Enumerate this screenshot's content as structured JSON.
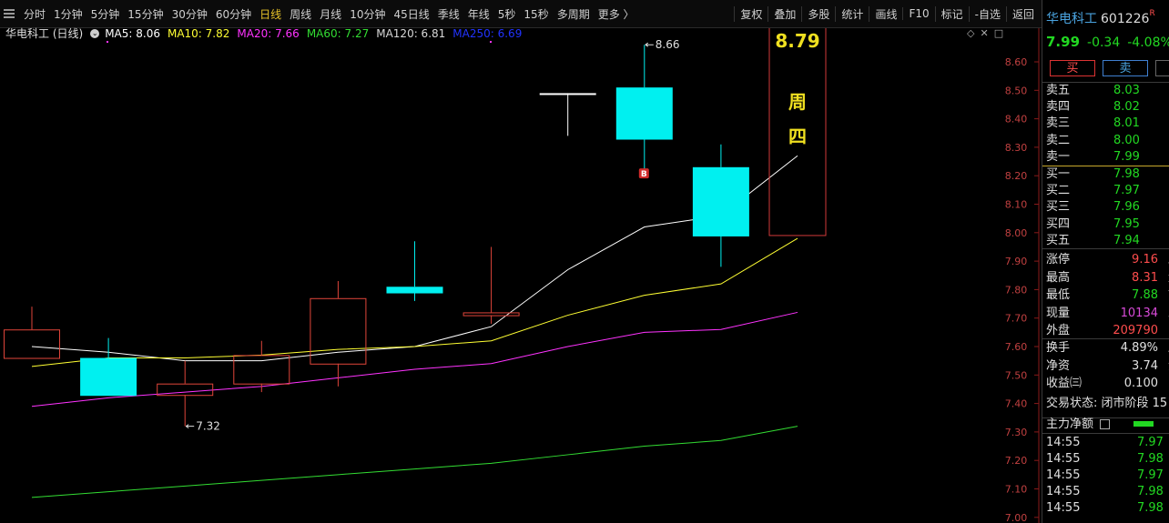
{
  "toolbar": {
    "periods": [
      "分时",
      "1分钟",
      "5分钟",
      "15分钟",
      "30分钟",
      "60分钟",
      "日线",
      "周线",
      "月线",
      "10分钟",
      "45日线",
      "季线",
      "年线",
      "5秒",
      "15秒",
      "多周期",
      "更多 〉"
    ],
    "active_period": "日线",
    "actions": [
      "复权",
      "叠加",
      "多股",
      "统计",
      "画线",
      "F10",
      "标记",
      "-自选",
      "返回"
    ]
  },
  "legend": {
    "title": "华电科工 (日线)",
    "items": [
      {
        "label": "MA5: 8.06",
        "color": "#ffffff"
      },
      {
        "label": "MA10: 7.82",
        "color": "#ffff33"
      },
      {
        "label": "MA20: 7.66",
        "color": "#ff33ff"
      },
      {
        "label": "MA60: 7.27",
        "color": "#33dd33"
      },
      {
        "label": "MA120: 6.81",
        "color": "#d8d8d8"
      },
      {
        "label": "MA250: 6.69",
        "color": "#2233ff"
      }
    ]
  },
  "chart_data": {
    "type": "candlestick",
    "y_ticks": [
      "8.60",
      "8.50",
      "8.40",
      "8.30",
      "8.20",
      "8.10",
      "8.00",
      "7.90",
      "7.80",
      "7.70",
      "7.60",
      "7.50",
      "7.40",
      "7.30",
      "7.20",
      "7.10",
      "7.00"
    ],
    "candles": [
      {
        "open": 7.56,
        "close": 7.66,
        "high": 7.74,
        "low": 7.56,
        "dir": "up"
      },
      {
        "open": 7.56,
        "close": 7.43,
        "high": 7.63,
        "low": 7.43,
        "dir": "down"
      },
      {
        "open": 7.43,
        "close": 7.47,
        "high": 7.55,
        "low": 7.32,
        "dir": "up"
      },
      {
        "open": 7.47,
        "close": 7.57,
        "high": 7.62,
        "low": 7.44,
        "dir": "up"
      },
      {
        "open": 7.54,
        "close": 7.77,
        "high": 7.83,
        "low": 7.46,
        "dir": "up"
      },
      {
        "open": 7.81,
        "close": 7.79,
        "high": 7.97,
        "low": 7.76,
        "dir": "down"
      },
      {
        "open": 7.71,
        "close": 7.72,
        "high": 7.95,
        "low": 7.68,
        "dir": "up"
      },
      {
        "open": 8.49,
        "close": 8.49,
        "high": 8.49,
        "low": 8.34,
        "dir": "flat"
      },
      {
        "open": 8.51,
        "close": 8.33,
        "high": 8.66,
        "low": 8.21,
        "dir": "down"
      },
      {
        "open": 8.23,
        "close": 7.99,
        "high": 8.31,
        "low": 7.88,
        "dir": "down"
      },
      {
        "open": 8.79,
        "close": 7.99,
        "high": 8.79,
        "low": 7.99,
        "dir": "preview"
      }
    ],
    "series": [
      {
        "name": "MA5",
        "color": "#ffffff",
        "values": [
          7.6,
          7.58,
          7.55,
          7.55,
          7.58,
          7.6,
          7.67,
          7.87,
          8.02,
          8.06,
          8.27
        ]
      },
      {
        "name": "MA10",
        "color": "#ffff33",
        "values": [
          7.53,
          7.56,
          7.56,
          7.57,
          7.59,
          7.6,
          7.62,
          7.71,
          7.78,
          7.82,
          7.98
        ]
      },
      {
        "name": "MA20",
        "color": "#ff33ff",
        "values": [
          7.39,
          7.42,
          7.44,
          7.46,
          7.49,
          7.52,
          7.54,
          7.6,
          7.65,
          7.66,
          7.72
        ]
      },
      {
        "name": "MA60",
        "color": "#33dd33",
        "values": [
          7.07,
          7.09,
          7.11,
          7.13,
          7.15,
          7.17,
          7.19,
          7.22,
          7.25,
          7.27,
          7.32
        ]
      }
    ],
    "annotations": {
      "high_label": "8.66",
      "low_label": "7.32",
      "buy_marker": "B"
    },
    "preview": {
      "price": "8.79",
      "weekday": "周\n四"
    }
  },
  "panel": {
    "stock_name": "华电科工",
    "code": "601226",
    "badge": "R",
    "price": "7.99",
    "change": "-0.34",
    "pct": "-4.08%",
    "buy_btn": "买",
    "sell_btn": "卖",
    "asks": [
      {
        "label": "卖五",
        "price": "8.03"
      },
      {
        "label": "卖四",
        "price": "8.02"
      },
      {
        "label": "卖三",
        "price": "8.01"
      },
      {
        "label": "卖二",
        "price": "8.00"
      },
      {
        "label": "卖一",
        "price": "7.99"
      }
    ],
    "bids": [
      {
        "label": "买一",
        "price": "7.98"
      },
      {
        "label": "买二",
        "price": "7.97"
      },
      {
        "label": "买三",
        "price": "7.96"
      },
      {
        "label": "买四",
        "price": "7.95"
      },
      {
        "label": "买五",
        "price": "7.94"
      }
    ],
    "stats1": [
      {
        "label": "涨停",
        "value": "9.16",
        "color": "#ff4d4d",
        "label2": "跌停"
      },
      {
        "label": "最高",
        "value": "8.31",
        "color": "#ff4d4d",
        "label2": "量比"
      },
      {
        "label": "最低",
        "value": "7.88",
        "color": "#22d822",
        "label2": "市值"
      },
      {
        "label": "现量",
        "value": "10134",
        "color": "#d84ad8",
        "label2": "总量"
      },
      {
        "label": "外盘",
        "value": "209790",
        "color": "#ff4d4d",
        "label2": "内盘"
      }
    ],
    "stats2": [
      {
        "label": "换手",
        "value": "4.89%",
        "color": "#e0e0e0",
        "label2": "股本"
      },
      {
        "label": "净资",
        "value": "3.74",
        "color": "#e0e0e0",
        "label2": "流通"
      },
      {
        "label": "收益㈢",
        "value": "0.100",
        "color": "#e0e0e0",
        "label2": "PE"
      }
    ],
    "trade_status": "交易状态: 闭市阶段 15",
    "mainforce_label": "主力净额",
    "ticks": [
      {
        "time": "14:55",
        "price": "7.97"
      },
      {
        "time": "14:55",
        "price": "7.98"
      },
      {
        "time": "14:55",
        "price": "7.97"
      },
      {
        "time": "14:55",
        "price": "7.98"
      },
      {
        "time": "14:55",
        "price": "7.98"
      }
    ]
  }
}
